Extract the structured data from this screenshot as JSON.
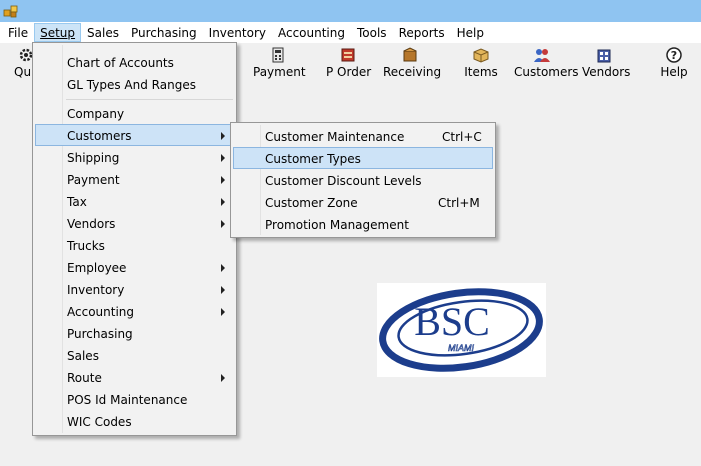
{
  "menubar": {
    "items": [
      "File",
      "Setup",
      "Sales",
      "Purchasing",
      "Inventory",
      "Accounting",
      "Tools",
      "Reports",
      "Help"
    ]
  },
  "toolbar": {
    "quick_partial": "Quic",
    "payment": "Payment",
    "p_order": "P Order",
    "receiving": "Receiving",
    "items": "Items",
    "customers": "Customers",
    "vendors": "Vendors",
    "help": "Help"
  },
  "setup_menu": {
    "items": [
      "Chart of Accounts",
      "GL Types And Ranges",
      "Company",
      "Customers",
      "Shipping",
      "Payment",
      "Tax",
      "Vendors",
      "Trucks",
      "Employee",
      "Inventory",
      "Accounting",
      "Purchasing",
      "Sales",
      "Route",
      "POS Id Maintenance",
      "WIC Codes"
    ]
  },
  "customers_submenu": {
    "items": [
      {
        "label": "Customer Maintenance",
        "shortcut": "Ctrl+C"
      },
      {
        "label": "Customer Types",
        "shortcut": ""
      },
      {
        "label": "Customer Discount Levels",
        "shortcut": ""
      },
      {
        "label": "Customer Zone",
        "shortcut": "Ctrl+M"
      },
      {
        "label": "Promotion Management",
        "shortcut": ""
      }
    ]
  },
  "logo": {
    "main": "BSC",
    "sub": "MIAMI"
  },
  "colors": {
    "titlebar": "#8fc4f1",
    "menu_highlight": "#cde3f7",
    "logo_blue": "#1c3d8c"
  }
}
